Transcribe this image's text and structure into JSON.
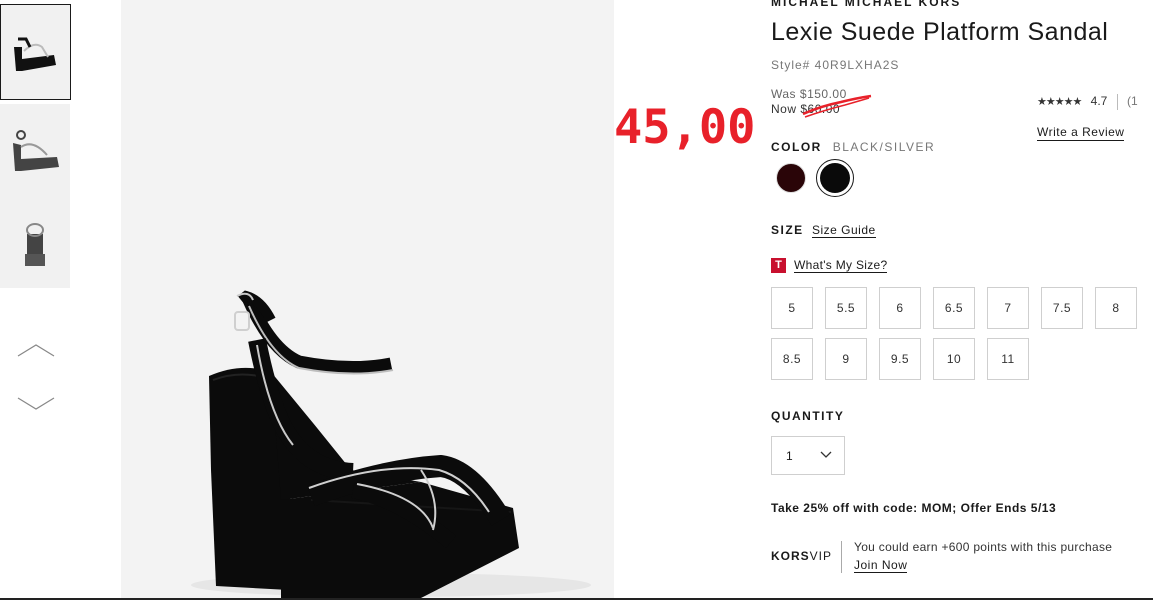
{
  "product": {
    "brand": "MICHAEL MICHAEL KORS",
    "title": "Lexie Suede Platform Sandal",
    "style": "Style# 40R9LXHA2S",
    "was_price": "Was $150.00",
    "now_price": "Now $60.00",
    "annotated_price": "45,00",
    "rating_stars": "★★★★★",
    "rating_value": "4.7",
    "review_count_fragment": "(1",
    "write_review": "Write a Review"
  },
  "color": {
    "label": "COLOR",
    "selected": "BLACK/SILVER",
    "swatches": [
      {
        "name": "burgundy",
        "hex": "#2a0508"
      },
      {
        "name": "black",
        "hex": "#0a0a0a"
      }
    ]
  },
  "size": {
    "label": "SIZE",
    "guide": "Size Guide",
    "badge": "T",
    "whats_my_size": "What's My Size?",
    "options": [
      "5",
      "5.5",
      "6",
      "6.5",
      "7",
      "7.5",
      "8",
      "8.5",
      "9",
      "9.5",
      "10",
      "11"
    ]
  },
  "quantity": {
    "label": "QUANTITY",
    "value": "1"
  },
  "promo": "Take 25% off with code: MOM; Offer Ends 5/13",
  "korsvip": {
    "brand_bold": "KORS",
    "brand_light": "VIP",
    "text": "You could earn +600 points with this purchase",
    "join": "Join Now"
  },
  "icons": [
    "chevron-up-icon",
    "chevron-down-icon",
    "dropdown-chevron-icon"
  ],
  "colors": {
    "annotation_red": "#e8212a",
    "badge_red": "#c8102e",
    "image_bg": "#f3f3f3"
  }
}
